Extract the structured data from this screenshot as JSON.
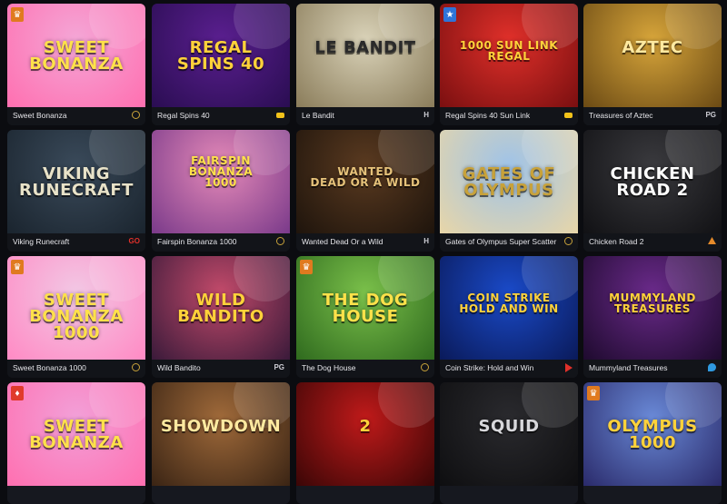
{
  "games": [
    {
      "name": "Sweet Bonanza",
      "art": "SWEET\nBONANZA",
      "provider_icon": "pragmatic-icon",
      "provider": "",
      "badge": "crown",
      "bg": [
        "#f4a6d6",
        "#ff6fb0"
      ],
      "artColor": "#ffe14a"
    },
    {
      "name": "Regal Spins 40",
      "art": "REGAL\nSPINS 40",
      "provider_icon": "bgaming-icon",
      "provider": "",
      "badge": "",
      "bg": [
        "#5a1f8f",
        "#2a0d52"
      ],
      "artColor": "#ffd23a"
    },
    {
      "name": "Le Bandit",
      "art": "LE BANDIT",
      "provider_icon": "hacksaw-icon",
      "provider": "H",
      "badge": "",
      "bg": [
        "#d9d2b8",
        "#8a7c5a"
      ],
      "artColor": "#2a2a2a"
    },
    {
      "name": "Regal Spins 40 Sun Link",
      "art": "1000 SUN LINK\nREGAL",
      "provider_icon": "bgaming-icon",
      "provider": "",
      "badge": "star",
      "bg": [
        "#e0302a",
        "#7a0f10"
      ],
      "artColor": "#ffd23a"
    },
    {
      "name": "Treasures of Aztec",
      "art": "AZTEC",
      "provider_icon": "pg-icon",
      "provider": "PG",
      "badge": "",
      "bg": [
        "#d7a53a",
        "#6b4a14"
      ],
      "artColor": "#ffe9a0"
    },
    {
      "name": "Viking Runecraft",
      "art": "VIKING\nRUNECRAFT",
      "provider_icon": "playngo-icon",
      "provider": "GO",
      "badge": "",
      "bg": [
        "#3a4a5a",
        "#1a242e"
      ],
      "artColor": "#e8e2c8"
    },
    {
      "name": "Fairspin Bonanza 1000",
      "art": "FAIRSPIN\nBONANZA\n1000",
      "provider_icon": "pragmatic-icon",
      "provider": "",
      "badge": "",
      "bg": [
        "#e58ab8",
        "#7a3a8a"
      ],
      "artColor": "#ffe14a"
    },
    {
      "name": "Wanted Dead Or a Wild",
      "art": "WANTED\nDEAD OR A WILD",
      "provider_icon": "hacksaw-icon",
      "provider": "H",
      "badge": "",
      "bg": [
        "#5a3a20",
        "#1e140c"
      ],
      "artColor": "#e6c27a"
    },
    {
      "name": "Gates of Olympus Super Scatter",
      "art": "GATES OF\nOLYMPUS",
      "provider_icon": "pragmatic-icon",
      "provider": "",
      "badge": "",
      "bg": [
        "#9fc3e8",
        "#e8d6a8"
      ],
      "artColor": "#c8a23a"
    },
    {
      "name": "Chicken Road 2",
      "art": "CHICKEN\nROAD 2",
      "provider_icon": "inout-icon",
      "provider": "",
      "badge": "",
      "bg": [
        "#3a3a3e",
        "#111114"
      ],
      "artColor": "#ffffff"
    },
    {
      "name": "Sweet Bonanza 1000",
      "art": "SWEET BONANZA\n1000",
      "provider_icon": "pragmatic-icon",
      "provider": "",
      "badge": "crown",
      "bg": [
        "#f2c7e4",
        "#ff8ac4"
      ],
      "artColor": "#ffe14a"
    },
    {
      "name": "Wild Bandito",
      "art": "WILD\nBANDITO",
      "provider_icon": "pg-icon",
      "provider": "PG",
      "badge": "",
      "bg": [
        "#c24a6a",
        "#3a1a3a"
      ],
      "artColor": "#ffd23a"
    },
    {
      "name": "The Dog House",
      "art": "THE DOG HOUSE",
      "provider_icon": "pragmatic-icon",
      "provider": "",
      "badge": "crown",
      "bg": [
        "#7ac04a",
        "#2f6a1e"
      ],
      "artColor": "#ffe14a"
    },
    {
      "name": "Coin Strike: Hold and Win",
      "art": "COIN STRIKE\nHOLD AND WIN",
      "provider_icon": "playson-icon",
      "provider": "",
      "badge": "",
      "bg": [
        "#1a4ac8",
        "#0a1a5a"
      ],
      "artColor": "#ffd23a"
    },
    {
      "name": "Mummyland Treasures",
      "art": "MUMMYLAND\nTREASURES",
      "provider_icon": "belatra-icon",
      "provider": "",
      "badge": "",
      "bg": [
        "#6a2a8a",
        "#1e0a2e"
      ],
      "artColor": "#ffd23a"
    },
    {
      "name": "",
      "art": "SWEET\nBONANZA",
      "provider_icon": "",
      "provider": "",
      "badge": "fire",
      "bg": [
        "#f2a0d8",
        "#ff6fb0"
      ],
      "artColor": "#ffe14a"
    },
    {
      "name": "",
      "art": "SHOWDOWN",
      "provider_icon": "",
      "provider": "",
      "badge": "",
      "bg": [
        "#a06a3a",
        "#3a2414"
      ],
      "artColor": "#ffe9a0"
    },
    {
      "name": "",
      "art": "2",
      "provider_icon": "",
      "provider": "",
      "badge": "",
      "bg": [
        "#c01a1a",
        "#3a0606"
      ],
      "artColor": "#ffd23a"
    },
    {
      "name": "",
      "art": "SQUID",
      "provider_icon": "",
      "provider": "",
      "badge": "",
      "bg": [
        "#2a2a2e",
        "#0e0e10"
      ],
      "artColor": "#d8d8dc"
    },
    {
      "name": "",
      "art": "OLYMPUS\n1000",
      "provider_icon": "",
      "provider": "",
      "badge": "crown",
      "bg": [
        "#6a8ad8",
        "#2a2a6a"
      ],
      "artColor": "#ffd23a"
    }
  ]
}
